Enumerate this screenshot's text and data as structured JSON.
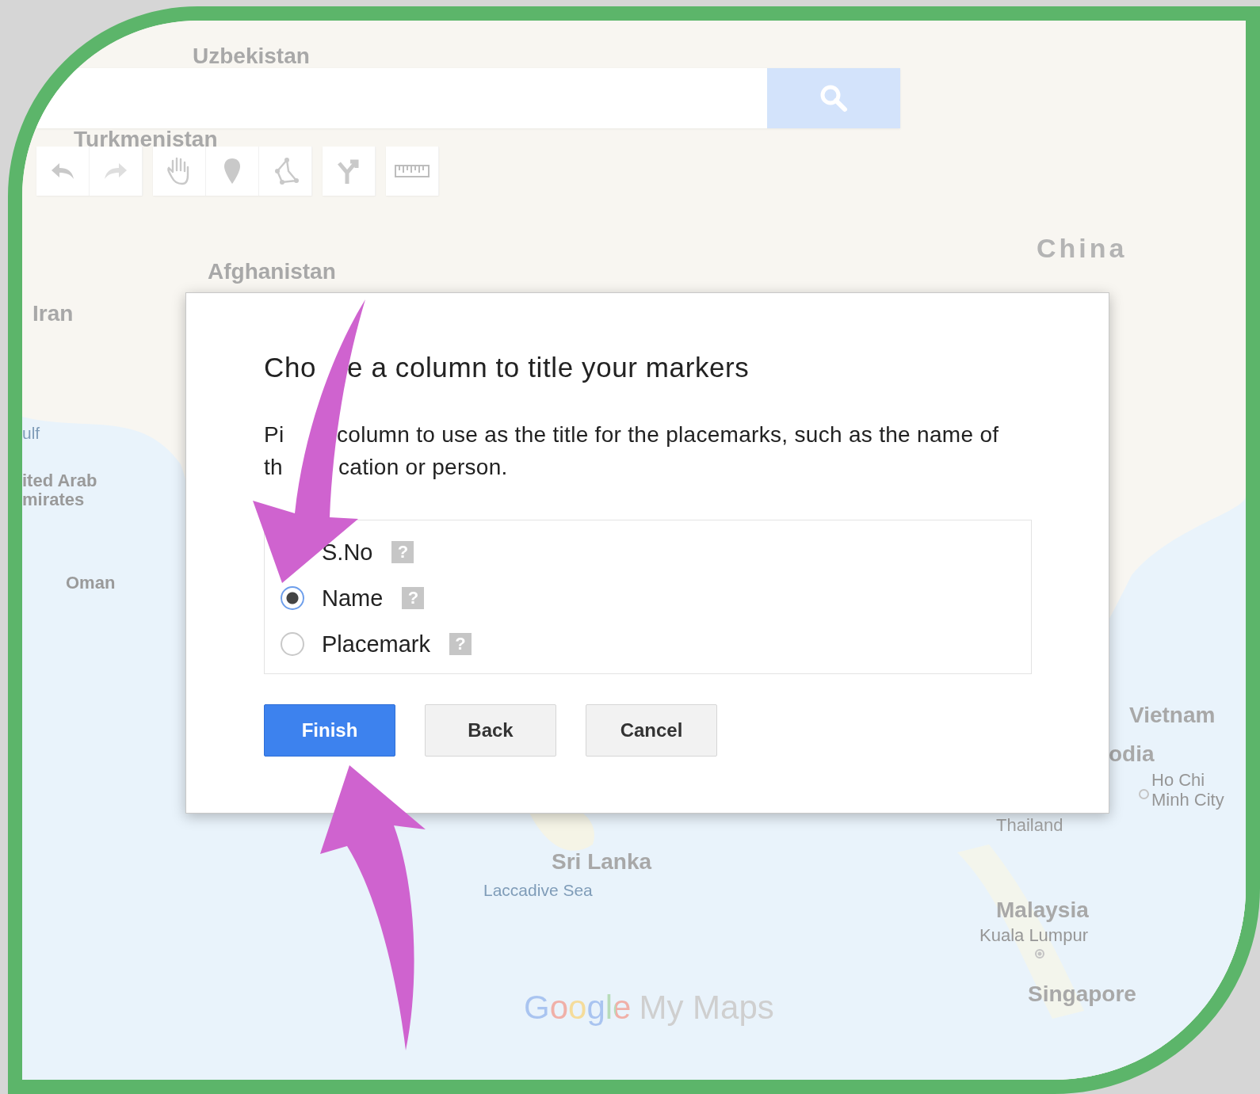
{
  "map_labels": [
    {
      "text": "Uzbekistan",
      "kind": "country"
    },
    {
      "text": "Turkmenistan",
      "kind": "country"
    },
    {
      "text": "Afghanistan",
      "kind": "country"
    },
    {
      "text": "China",
      "kind": "major"
    },
    {
      "text": "Iran",
      "kind": "country"
    },
    {
      "text": "ulf",
      "kind": "water"
    },
    {
      "text": "ited Arab",
      "kind": "region"
    },
    {
      "text": "mirates",
      "kind": "region"
    },
    {
      "text": "Oman",
      "kind": "region"
    },
    {
      "text": "Vietnam",
      "kind": "country"
    },
    {
      "text": "odia",
      "kind": "country"
    },
    {
      "text": "Ho Chi Minh City",
      "kind": "city"
    },
    {
      "text": "Thailand",
      "kind": "faint"
    },
    {
      "text": "Sri Lanka",
      "kind": "country"
    },
    {
      "text": "Laccadive Sea",
      "kind": "water"
    },
    {
      "text": "Malaysia",
      "kind": "country"
    },
    {
      "text": "Kuala Lumpur",
      "kind": "capital"
    },
    {
      "text": "Singapore",
      "kind": "country"
    }
  ],
  "logo": {
    "brand": "Google",
    "product": "My Maps"
  },
  "dialog": {
    "title_parts": [
      "Cho",
      "e a column to title your markers"
    ],
    "description_lines": [
      [
        "Pi",
        "column to use as the title for the placemarks, such as the name of"
      ],
      [
        "th",
        "cation or person."
      ]
    ],
    "options": [
      {
        "label": "S.No",
        "help": "?"
      },
      {
        "label": "Name",
        "selected": true,
        "help": "?"
      },
      {
        "label": "Placemark",
        "selected": false,
        "help": "?"
      }
    ],
    "buttons": [
      {
        "label": "Finish",
        "kind": "primary"
      },
      {
        "label": "Back",
        "kind": "secondary"
      },
      {
        "label": "Cancel",
        "kind": "secondary"
      }
    ]
  }
}
